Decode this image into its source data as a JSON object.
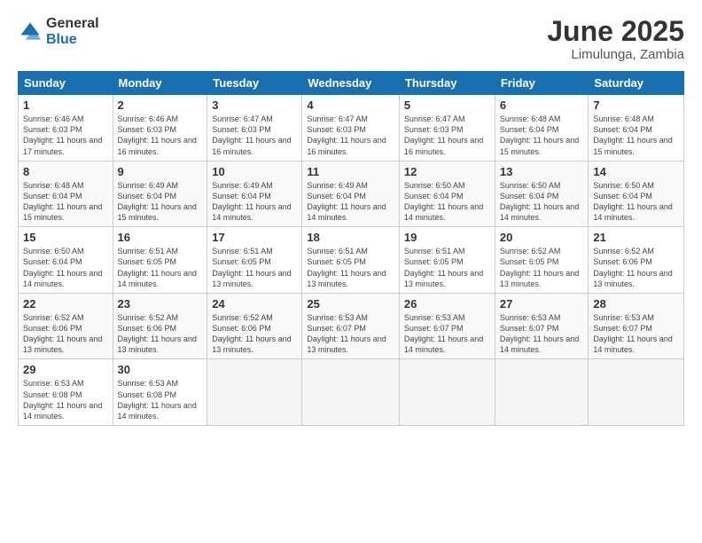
{
  "logo": {
    "general": "General",
    "blue": "Blue"
  },
  "title": {
    "month_year": "June 2025",
    "location": "Limulunga, Zambia"
  },
  "days_of_week": [
    "Sunday",
    "Monday",
    "Tuesday",
    "Wednesday",
    "Thursday",
    "Friday",
    "Saturday"
  ],
  "weeks": [
    [
      {
        "num": "1",
        "sunrise": "6:46 AM",
        "sunset": "6:03 PM",
        "daylight": "11 hours and 17 minutes."
      },
      {
        "num": "2",
        "sunrise": "6:46 AM",
        "sunset": "6:03 PM",
        "daylight": "11 hours and 16 minutes."
      },
      {
        "num": "3",
        "sunrise": "6:47 AM",
        "sunset": "6:03 PM",
        "daylight": "11 hours and 16 minutes."
      },
      {
        "num": "4",
        "sunrise": "6:47 AM",
        "sunset": "6:03 PM",
        "daylight": "11 hours and 16 minutes."
      },
      {
        "num": "5",
        "sunrise": "6:47 AM",
        "sunset": "6:03 PM",
        "daylight": "11 hours and 16 minutes."
      },
      {
        "num": "6",
        "sunrise": "6:48 AM",
        "sunset": "6:04 PM",
        "daylight": "11 hours and 15 minutes."
      },
      {
        "num": "7",
        "sunrise": "6:48 AM",
        "sunset": "6:04 PM",
        "daylight": "11 hours and 15 minutes."
      }
    ],
    [
      {
        "num": "8",
        "sunrise": "6:48 AM",
        "sunset": "6:04 PM",
        "daylight": "11 hours and 15 minutes."
      },
      {
        "num": "9",
        "sunrise": "6:49 AM",
        "sunset": "6:04 PM",
        "daylight": "11 hours and 15 minutes."
      },
      {
        "num": "10",
        "sunrise": "6:49 AM",
        "sunset": "6:04 PM",
        "daylight": "11 hours and 14 minutes."
      },
      {
        "num": "11",
        "sunrise": "6:49 AM",
        "sunset": "6:04 PM",
        "daylight": "11 hours and 14 minutes."
      },
      {
        "num": "12",
        "sunrise": "6:50 AM",
        "sunset": "6:04 PM",
        "daylight": "11 hours and 14 minutes."
      },
      {
        "num": "13",
        "sunrise": "6:50 AM",
        "sunset": "6:04 PM",
        "daylight": "11 hours and 14 minutes."
      },
      {
        "num": "14",
        "sunrise": "6:50 AM",
        "sunset": "6:04 PM",
        "daylight": "11 hours and 14 minutes."
      }
    ],
    [
      {
        "num": "15",
        "sunrise": "6:50 AM",
        "sunset": "6:04 PM",
        "daylight": "11 hours and 14 minutes."
      },
      {
        "num": "16",
        "sunrise": "6:51 AM",
        "sunset": "6:05 PM",
        "daylight": "11 hours and 14 minutes."
      },
      {
        "num": "17",
        "sunrise": "6:51 AM",
        "sunset": "6:05 PM",
        "daylight": "11 hours and 13 minutes."
      },
      {
        "num": "18",
        "sunrise": "6:51 AM",
        "sunset": "6:05 PM",
        "daylight": "11 hours and 13 minutes."
      },
      {
        "num": "19",
        "sunrise": "6:51 AM",
        "sunset": "6:05 PM",
        "daylight": "11 hours and 13 minutes."
      },
      {
        "num": "20",
        "sunrise": "6:52 AM",
        "sunset": "6:05 PM",
        "daylight": "11 hours and 13 minutes."
      },
      {
        "num": "21",
        "sunrise": "6:52 AM",
        "sunset": "6:06 PM",
        "daylight": "11 hours and 13 minutes."
      }
    ],
    [
      {
        "num": "22",
        "sunrise": "6:52 AM",
        "sunset": "6:06 PM",
        "daylight": "11 hours and 13 minutes."
      },
      {
        "num": "23",
        "sunrise": "6:52 AM",
        "sunset": "6:06 PM",
        "daylight": "11 hours and 13 minutes."
      },
      {
        "num": "24",
        "sunrise": "6:52 AM",
        "sunset": "6:06 PM",
        "daylight": "11 hours and 13 minutes."
      },
      {
        "num": "25",
        "sunrise": "6:53 AM",
        "sunset": "6:07 PM",
        "daylight": "11 hours and 13 minutes."
      },
      {
        "num": "26",
        "sunrise": "6:53 AM",
        "sunset": "6:07 PM",
        "daylight": "11 hours and 14 minutes."
      },
      {
        "num": "27",
        "sunrise": "6:53 AM",
        "sunset": "6:07 PM",
        "daylight": "11 hours and 14 minutes."
      },
      {
        "num": "28",
        "sunrise": "6:53 AM",
        "sunset": "6:07 PM",
        "daylight": "11 hours and 14 minutes."
      }
    ],
    [
      {
        "num": "29",
        "sunrise": "6:53 AM",
        "sunset": "6:08 PM",
        "daylight": "11 hours and 14 minutes."
      },
      {
        "num": "30",
        "sunrise": "6:53 AM",
        "sunset": "6:08 PM",
        "daylight": "11 hours and 14 minutes."
      },
      null,
      null,
      null,
      null,
      null
    ]
  ]
}
